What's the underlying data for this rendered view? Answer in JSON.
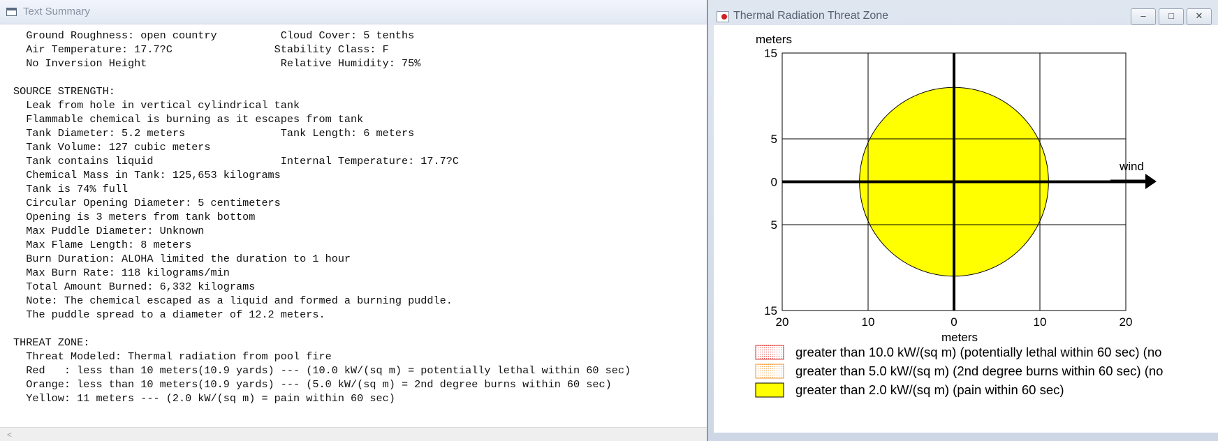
{
  "text_summary": {
    "title": "Text Summary",
    "lines": [
      "  Ground Roughness: open country          Cloud Cover: 5 tenths",
      "  Air Temperature: 17.7?C                Stability Class: F",
      "  No Inversion Height                     Relative Humidity: 75%",
      "",
      "SOURCE STRENGTH:",
      "  Leak from hole in vertical cylindrical tank",
      "  Flammable chemical is burning as it escapes from tank",
      "  Tank Diameter: 5.2 meters               Tank Length: 6 meters",
      "  Tank Volume: 127 cubic meters",
      "  Tank contains liquid                    Internal Temperature: 17.7?C",
      "  Chemical Mass in Tank: 125,653 kilograms",
      "  Tank is 74% full",
      "  Circular Opening Diameter: 5 centimeters",
      "  Opening is 3 meters from tank bottom",
      "  Max Puddle Diameter: Unknown",
      "  Max Flame Length: 8 meters",
      "  Burn Duration: ALOHA limited the duration to 1 hour",
      "  Max Burn Rate: 118 kilograms/min",
      "  Total Amount Burned: 6,332 kilograms",
      "  Note: The chemical escaped as a liquid and formed a burning puddle.",
      "  The puddle spread to a diameter of 12.2 meters.",
      "",
      "THREAT ZONE:",
      "  Threat Modeled: Thermal radiation from pool fire",
      "  Red   : less than 10 meters(10.9 yards) --- (10.0 kW/(sq m) = potentially lethal within 60 sec)",
      "  Orange: less than 10 meters(10.9 yards) --- (5.0 kW/(sq m) = 2nd degree burns within 60 sec)",
      "  Yellow: 11 meters --- (2.0 kW/(sq m) = pain within 60 sec)"
    ],
    "scroll_left_arrow": "<"
  },
  "threat_zone": {
    "title": "Thermal Radiation Threat Zone",
    "buttons": {
      "minimize": "–",
      "maximize": "□",
      "close": "✕"
    },
    "icons": {
      "app": "aloha-app-icon"
    },
    "wind_label": "wind",
    "legend": [
      {
        "label": "greater than 10.0 kW/(sq m) (potentially lethal within 60 sec) (no",
        "color": "#e23b3b",
        "pattern": "dotted"
      },
      {
        "label": "greater than 5.0 kW/(sq m) (2nd degree burns within 60 sec) (no",
        "color": "#f39b3e",
        "pattern": "dotted"
      },
      {
        "label": "greater than 2.0 kW/(sq m) (pain within 60 sec)",
        "color": "#ffff00",
        "pattern": "solid"
      }
    ]
  },
  "chart_data": {
    "type": "scatter",
    "title": "",
    "xlabel": "meters",
    "ylabel": "meters",
    "xlim": [
      -20,
      20
    ],
    "ylim": [
      -15,
      15
    ],
    "xticks": [
      -20,
      -10,
      0,
      10,
      20
    ],
    "xtick_labels": [
      "20",
      "10",
      "0",
      "10",
      "20"
    ],
    "yticks": [
      15,
      5,
      0,
      -5,
      -15
    ],
    "ytick_labels": [
      "15",
      "5",
      "0",
      "5",
      "15"
    ],
    "grid": true,
    "zones": [
      {
        "name": "Yellow",
        "shape": "circle",
        "center": [
          0,
          0
        ],
        "radius": 11,
        "color": "#ffff00"
      }
    ]
  }
}
